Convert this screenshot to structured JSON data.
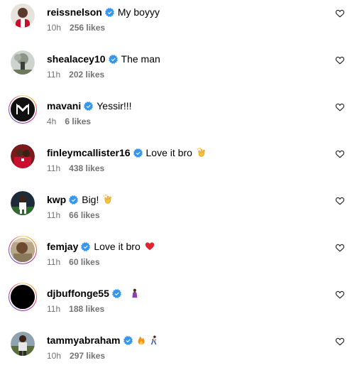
{
  "colors": {
    "verified": "#3797F0",
    "secondary_text": "#737373",
    "primary_text": "#000000"
  },
  "comments": [
    {
      "username": "reissnelson",
      "text": "My boyyy",
      "time": "10h",
      "likes": "256 likes",
      "emojis": []
    },
    {
      "username": "shealacey10",
      "text": "The man",
      "time": "11h",
      "likes": "202 likes",
      "emojis": []
    },
    {
      "username": "mavani",
      "text": "Yessir!!!",
      "time": "4h",
      "likes": "6 likes",
      "emojis": []
    },
    {
      "username": "finleymcallister16",
      "text": "Love it bro",
      "time": "11h",
      "likes": "438 likes",
      "emojis": [
        "clapping-hands-emoji"
      ]
    },
    {
      "username": "kwp",
      "text": "Big!",
      "time": "11h",
      "likes": "66 likes",
      "emojis": [
        "clapping-hands-emoji"
      ]
    },
    {
      "username": "femjay",
      "text": "Love it bro",
      "time": "11h",
      "likes": "60 likes",
      "emojis": [
        "red-heart-emoji"
      ]
    },
    {
      "username": "djbuffonge55",
      "text": "",
      "time": "11h",
      "likes": "188 likes",
      "emojis": [
        "person-emoji"
      ]
    },
    {
      "username": "tammyabraham",
      "text": "",
      "time": "10h",
      "likes": "297 likes",
      "emojis": [
        "fire-emoji",
        "person-walking-emoji"
      ]
    }
  ]
}
